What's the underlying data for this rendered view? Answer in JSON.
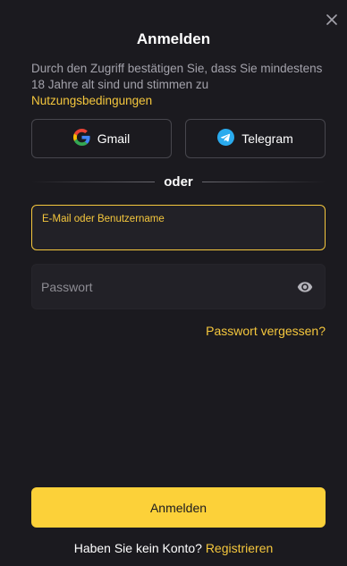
{
  "dialog": {
    "title": "Anmelden",
    "close_icon": "close-icon"
  },
  "consent": {
    "text": "Durch den Zugriff bestätigen Sie, dass Sie mindestens 18 Jahre alt sind und stimmen zu ",
    "link": "Nutzungsbedingungen"
  },
  "social": {
    "gmail_label": "Gmail",
    "gmail_icon": "google-icon",
    "telegram_label": "Telegram",
    "telegram_icon": "telegram-icon"
  },
  "divider": {
    "text": "oder"
  },
  "email": {
    "label": "E-Mail oder Benutzername",
    "value": ""
  },
  "password": {
    "placeholder": "Passwort",
    "value": "",
    "toggle_icon": "eye-icon"
  },
  "forgot_label": "Passwort vergessen?",
  "submit_label": "Anmelden",
  "signup": {
    "text": "Haben Sie kein Konto?",
    "link": "Registrieren"
  },
  "colors": {
    "background": "#1b1a1f",
    "accent": "#f5c73d",
    "button": "#fcd139",
    "muted_text": "#a3a2ab",
    "field_bg": "#222127"
  }
}
